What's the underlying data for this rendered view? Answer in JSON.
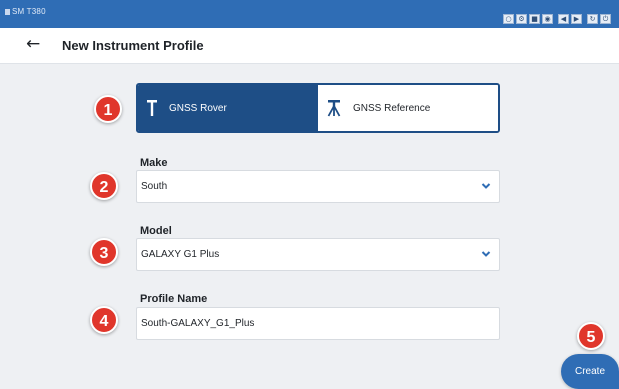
{
  "statusbar": {
    "device": "SM T380",
    "icons": [
      "headset-icon",
      "settings-icon",
      "record-icon",
      "camera-icon",
      "volume-down-icon",
      "volume-up-icon",
      "rotate-icon",
      "power-icon"
    ]
  },
  "header": {
    "back_icon": "arrow-left-icon",
    "title": "New Instrument Profile"
  },
  "badges": [
    "1",
    "2",
    "3",
    "4",
    "5"
  ],
  "instrument_type": {
    "options": [
      {
        "label": "GNSS Rover",
        "icon": "rover-pole-icon",
        "selected": true
      },
      {
        "label": "GNSS Reference",
        "icon": "tripod-icon",
        "selected": false
      }
    ]
  },
  "make": {
    "label": "Make",
    "value": "South"
  },
  "model": {
    "label": "Model",
    "value": "GALAXY G1 Plus"
  },
  "profile_name": {
    "label": "Profile Name",
    "value": "South-GALAXY_G1_Plus"
  },
  "create_button": {
    "label": "Create"
  },
  "colors": {
    "statusbar": "#2f6db5",
    "accent": "#1e4e86",
    "badge": "#e0362b",
    "background": "#eef0f3"
  }
}
